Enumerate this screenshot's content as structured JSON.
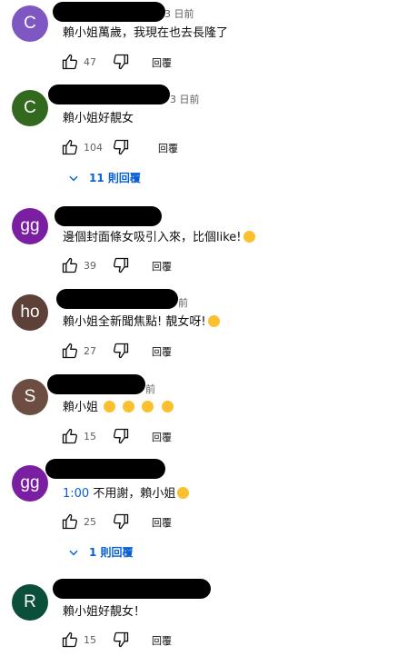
{
  "comments": [
    {
      "avatar_letter": "C",
      "avatar_color": "#7e57c2",
      "time": "3 日前",
      "text": "賴小姐萬歲，我現在也去長隆了",
      "likes": "47",
      "reply_label": "回覆"
    },
    {
      "avatar_letter": "C",
      "avatar_color": "#33691e",
      "time": "3 日前",
      "text": "賴小姐好靚女",
      "likes": "104",
      "reply_label": "回覆",
      "replies_label": "11 則回覆"
    },
    {
      "avatar_letter": "gg",
      "avatar_color": "#7b1fa2",
      "time": "",
      "text": "邊個封面條女吸引入來，比個like!",
      "likes": "39",
      "reply_label": "回覆",
      "emoji": "laughing-emoji"
    },
    {
      "avatar_letter": "ho",
      "avatar_color": "#5d4037",
      "time": "前",
      "text": "賴小姐全新聞焦點! 靚女呀!",
      "likes": "27",
      "reply_label": "回覆",
      "emoji": "grin-emoji"
    },
    {
      "avatar_letter": "S",
      "avatar_color": "#6d4c41",
      "time": "前",
      "text": "賴小姐",
      "likes": "15",
      "reply_label": "回覆",
      "emoji": "heart-eyes-emoji"
    },
    {
      "avatar_letter": "gg",
      "avatar_color": "#7b1fa2",
      "time": "",
      "timestamp_link": "1:00",
      "text": "不用謝，賴小姐",
      "likes": "25",
      "reply_label": "回覆",
      "replies_label": "1 則回覆",
      "emoji": "smile-emoji"
    },
    {
      "avatar_letter": "R",
      "avatar_color": "#0b4f3b",
      "time": "",
      "text": "賴小姐好靚女！",
      "likes": "15",
      "reply_label": "回覆"
    }
  ],
  "icons": {
    "like": "thumbs-up-icon",
    "dislike": "thumbs-down-icon",
    "expand": "chevron-down-icon"
  }
}
